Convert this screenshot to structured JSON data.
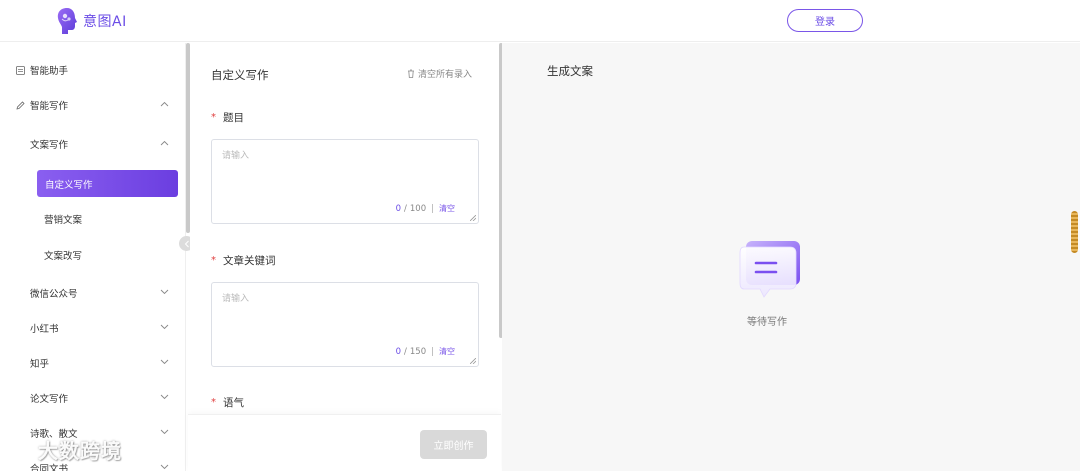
{
  "header": {
    "logo_text": "意图AI",
    "login_label": "登录",
    "accent": "#6b4de6"
  },
  "sidebar": {
    "items": [
      {
        "label": "智能助手",
        "icon": "doc-icon"
      },
      {
        "label": "智能写作",
        "icon": "pencil-icon"
      },
      {
        "label": "文案写作"
      },
      {
        "label": "自定义写作",
        "active": true
      },
      {
        "label": "营销文案"
      },
      {
        "label": "文案改写"
      },
      {
        "label": "微信公众号"
      },
      {
        "label": "小红书"
      },
      {
        "label": "知乎"
      },
      {
        "label": "论文写作"
      },
      {
        "label": "诗歌、散文"
      },
      {
        "label": "合同文书"
      }
    ]
  },
  "form": {
    "title": "自定义写作",
    "clear_all": "清空所有录入",
    "fields": [
      {
        "label": "题目",
        "placeholder": "请输入",
        "count": "0",
        "max": "100",
        "clear": "清空"
      },
      {
        "label": "文章关键词",
        "placeholder": "请输入",
        "count": "0",
        "max": "150",
        "clear": "清空"
      },
      {
        "label": "语气"
      }
    ],
    "create_label": "立即创作"
  },
  "result": {
    "title": "生成文案",
    "waiting": "等待写作"
  },
  "watermark": {
    "text": "大数跨境"
  }
}
